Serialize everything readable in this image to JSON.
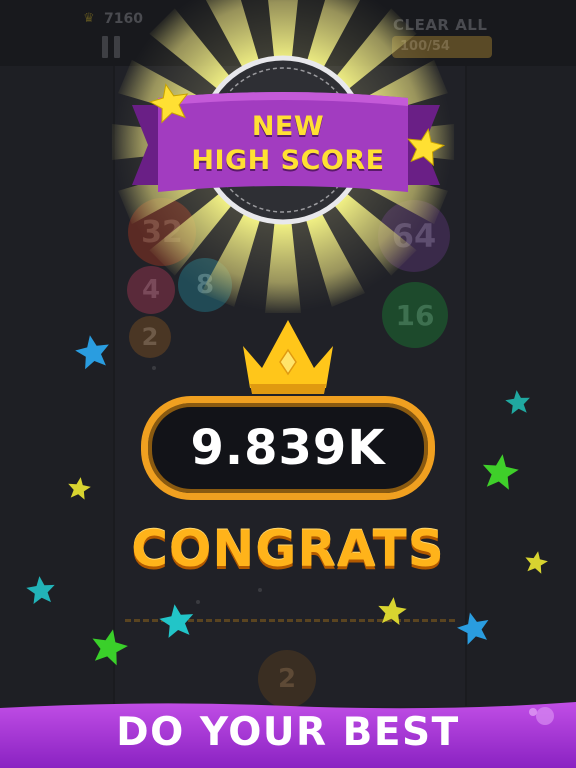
{
  "hud": {
    "best_score": "7160",
    "clear_all_label": "CLEAR ALL",
    "clear_counter": "100/54"
  },
  "board": {
    "balls": [
      {
        "label": "32",
        "color": "#5a2a24"
      },
      {
        "label": "4",
        "color": "#5a2a3a"
      },
      {
        "label": "8",
        "color": "#214a55"
      },
      {
        "label": "2",
        "color": "#4a3624"
      },
      {
        "label": "64",
        "color": "#3a2a4a"
      },
      {
        "label": "16",
        "color": "#1d4a2c"
      },
      {
        "label": "2",
        "color": "#3a2e22"
      }
    ]
  },
  "popup": {
    "banner_line1": "NEW",
    "banner_line2": "HIGH SCORE",
    "score": "9.839K",
    "congrats": "CONGRATS"
  },
  "footer": {
    "tagline": "DO YOUR BEST"
  },
  "colors": {
    "banner_purple": "#a23cc0",
    "banner_text": "#ffe033",
    "score_border": "#f0a020",
    "congrats": "#ffb31a",
    "footer_purple": "#a52ed6",
    "crown_gold": "#ffc61a"
  },
  "stars": [
    {
      "color": "#ffe033",
      "name": "star-yellow"
    },
    {
      "color": "#ffe033",
      "name": "star-yellow"
    },
    {
      "color": "#2a9de0",
      "name": "star-blue"
    },
    {
      "color": "#d8d430",
      "name": "star-yellow"
    },
    {
      "color": "#22b3b8",
      "name": "star-teal"
    },
    {
      "color": "#22c5c8",
      "name": "star-teal"
    },
    {
      "color": "#3fcf2a",
      "name": "star-green"
    },
    {
      "color": "#20a8a0",
      "name": "star-teal"
    },
    {
      "color": "#3ad02a",
      "name": "star-green"
    },
    {
      "color": "#d8d430",
      "name": "star-yellow"
    },
    {
      "color": "#ffe033",
      "name": "star-yellow"
    },
    {
      "color": "#2a9de0",
      "name": "star-blue"
    }
  ]
}
